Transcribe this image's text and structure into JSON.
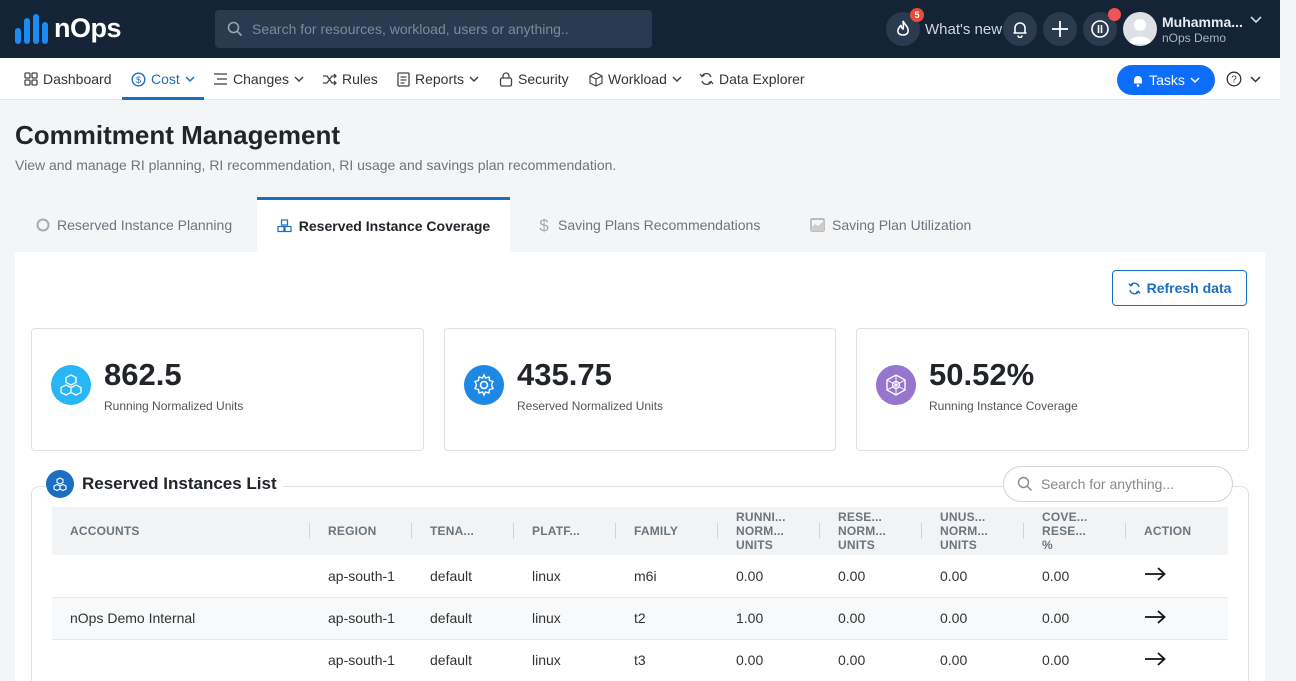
{
  "app": {
    "name": "nOps"
  },
  "topbar": {
    "search_placeholder": "Search for resources, workload, users or anything..",
    "notification_count": "5",
    "whats_new": "What's new",
    "user_name": "Muhamma...",
    "user_org": "nOps Demo"
  },
  "nav": {
    "items": [
      {
        "label": "Dashboard",
        "icon": "grid-icon"
      },
      {
        "label": "Cost",
        "icon": "dollar-circle-icon",
        "dropdown": true,
        "active": true
      },
      {
        "label": "Changes",
        "icon": "list-icon",
        "dropdown": true
      },
      {
        "label": "Rules",
        "icon": "shuffle-icon"
      },
      {
        "label": "Reports",
        "icon": "report-icon",
        "dropdown": true
      },
      {
        "label": "Security",
        "icon": "lock-icon"
      },
      {
        "label": "Workload",
        "icon": "cube-icon",
        "dropdown": true
      },
      {
        "label": "Data Explorer",
        "icon": "refresh-icon"
      }
    ],
    "tasks_label": "Tasks"
  },
  "page": {
    "title": "Commitment Management",
    "subtitle": "View and manage RI planning, RI recommendation, RI usage and savings plan recommendation."
  },
  "tabs": [
    {
      "label": "Reserved Instance Planning",
      "active": false
    },
    {
      "label": "Reserved Instance Coverage",
      "active": true
    },
    {
      "label": "Saving Plans Recommendations",
      "active": false
    },
    {
      "label": "Saving Plan Utilization",
      "active": false
    }
  ],
  "refresh_label": "Refresh data",
  "cards": [
    {
      "value": "862.5",
      "label": "Running Normalized Units",
      "color": "#29b6f6"
    },
    {
      "value": "435.75",
      "label": "Reserved Normalized Units",
      "color": "#1e88e5"
    },
    {
      "value": "50.52%",
      "label": "Running Instance Coverage",
      "color": "#9575cd"
    }
  ],
  "list": {
    "title": "Reserved Instances List",
    "search_placeholder": "Search for anything...",
    "columns": [
      [
        "ACCOUNTS"
      ],
      [
        "REGION"
      ],
      [
        "TENA..."
      ],
      [
        "PLATF..."
      ],
      [
        "FAMILY"
      ],
      [
        "RUNNI...",
        "NORM...",
        "UNITS"
      ],
      [
        "RESE...",
        "NORM...",
        "UNITS"
      ],
      [
        "UNUS...",
        "NORM...",
        "UNITS"
      ],
      [
        "COVE...",
        "RESE...",
        "%"
      ],
      [
        "ACTION"
      ]
    ],
    "rows": [
      {
        "account": "",
        "region": "ap-south-1",
        "tenancy": "default",
        "platform": "linux",
        "family": "m6i",
        "running": "0.00",
        "reserved": "0.00",
        "unused": "0.00",
        "coverage": "0.00"
      },
      {
        "account": "nOps Demo Internal",
        "region": "ap-south-1",
        "tenancy": "default",
        "platform": "linux",
        "family": "t2",
        "running": "1.00",
        "reserved": "0.00",
        "unused": "0.00",
        "coverage": "0.00"
      },
      {
        "account": "",
        "region": "ap-south-1",
        "tenancy": "default",
        "platform": "linux",
        "family": "t3",
        "running": "0.00",
        "reserved": "0.00",
        "unused": "0.00",
        "coverage": "0.00"
      }
    ]
  }
}
